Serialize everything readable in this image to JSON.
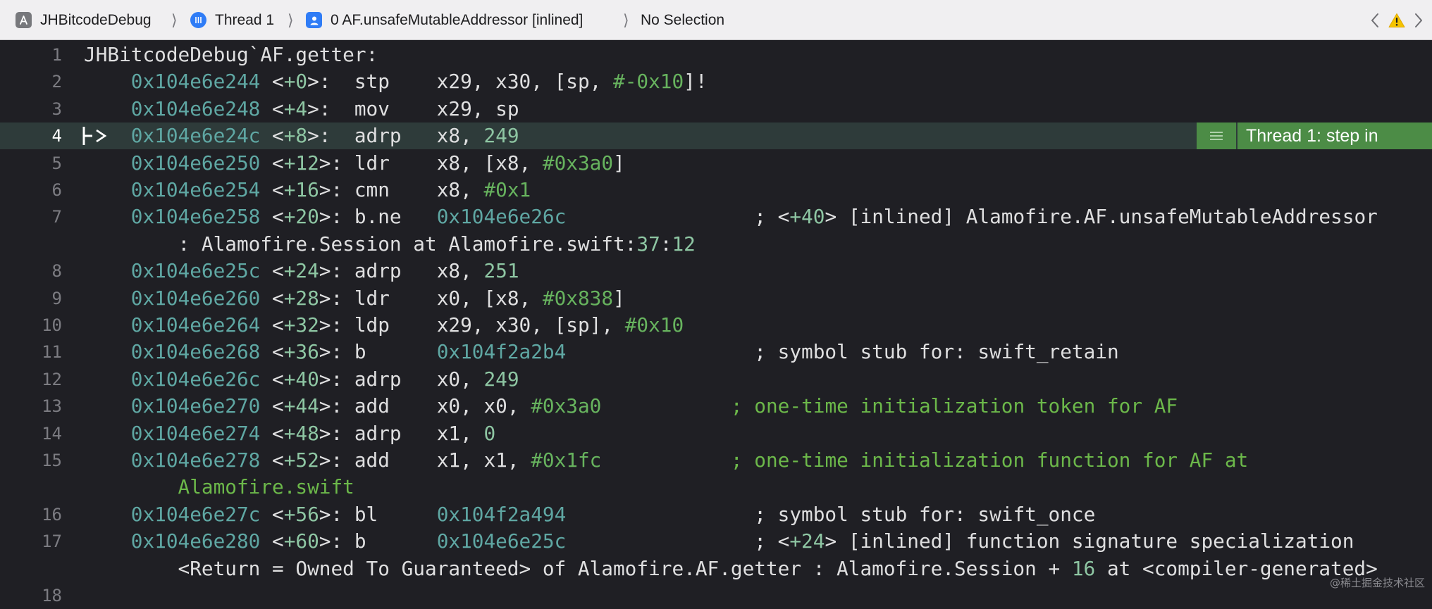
{
  "jumpbar": {
    "project": "JHBitcodeDebug",
    "thread": "Thread 1",
    "frame": "0 AF.unsafeMutableAddressor [inlined]",
    "selection": "No Selection",
    "separator": "⟩"
  },
  "badge": {
    "text": "Thread 1: step in"
  },
  "pc_marker": "├>",
  "watermark": "@稀土掘金技术社区",
  "lines": [
    {
      "n": "1",
      "segs": [
        {
          "c": "c-txt",
          "t": "JHBitcodeDebug`AF.getter:"
        }
      ]
    },
    {
      "n": "2",
      "segs": [
        {
          "c": "c-txt",
          "t": "    "
        },
        {
          "c": "c-addr",
          "t": "0x104e6e244"
        },
        {
          "c": "c-txt",
          "t": " <"
        },
        {
          "c": "c-num",
          "t": "+0"
        },
        {
          "c": "c-txt",
          "t": ">:  stp    x29, x30, [sp, "
        },
        {
          "c": "c-lit",
          "t": "#-0x10"
        },
        {
          "c": "c-txt",
          "t": "]!"
        }
      ]
    },
    {
      "n": "3",
      "segs": [
        {
          "c": "c-txt",
          "t": "    "
        },
        {
          "c": "c-addr",
          "t": "0x104e6e248"
        },
        {
          "c": "c-txt",
          "t": " <"
        },
        {
          "c": "c-num",
          "t": "+4"
        },
        {
          "c": "c-txt",
          "t": ">:  mov    x29, sp"
        }
      ]
    },
    {
      "n": "4",
      "segs": [
        {
          "c": "c-txt",
          "t": "    "
        },
        {
          "c": "c-addr",
          "t": "0x104e6e24c"
        },
        {
          "c": "c-txt",
          "t": " <"
        },
        {
          "c": "c-num",
          "t": "+8"
        },
        {
          "c": "c-txt",
          "t": ">:  adrp   x8, "
        },
        {
          "c": "c-num",
          "t": "249"
        }
      ]
    },
    {
      "n": "5",
      "segs": [
        {
          "c": "c-txt",
          "t": "    "
        },
        {
          "c": "c-addr",
          "t": "0x104e6e250"
        },
        {
          "c": "c-txt",
          "t": " <"
        },
        {
          "c": "c-num",
          "t": "+12"
        },
        {
          "c": "c-txt",
          "t": ">: ldr    x8, [x8, "
        },
        {
          "c": "c-lit",
          "t": "#0x3a0"
        },
        {
          "c": "c-txt",
          "t": "]"
        }
      ]
    },
    {
      "n": "6",
      "segs": [
        {
          "c": "c-txt",
          "t": "    "
        },
        {
          "c": "c-addr",
          "t": "0x104e6e254"
        },
        {
          "c": "c-txt",
          "t": " <"
        },
        {
          "c": "c-num",
          "t": "+16"
        },
        {
          "c": "c-txt",
          "t": ">: cmn    x8, "
        },
        {
          "c": "c-lit",
          "t": "#0x1"
        }
      ]
    },
    {
      "n": "7",
      "segs": [
        {
          "c": "c-txt",
          "t": "    "
        },
        {
          "c": "c-addr",
          "t": "0x104e6e258"
        },
        {
          "c": "c-txt",
          "t": " <"
        },
        {
          "c": "c-num",
          "t": "+20"
        },
        {
          "c": "c-txt",
          "t": ">: b.ne   "
        },
        {
          "c": "c-addr",
          "t": "0x104e6e26c"
        },
        {
          "c": "c-txt",
          "t": "                ; <"
        },
        {
          "c": "c-num",
          "t": "+40"
        },
        {
          "c": "c-txt",
          "t": "> [inlined] Alamofire.AF.unsafeMutableAddressor"
        }
      ]
    },
    {
      "n": "",
      "segs": [
        {
          "c": "c-txt",
          "t": "        : Alamofire.Session at Alamofire.swift:"
        },
        {
          "c": "c-num",
          "t": "37"
        },
        {
          "c": "c-txt",
          "t": ":"
        },
        {
          "c": "c-num",
          "t": "12"
        }
      ]
    },
    {
      "n": "8",
      "segs": [
        {
          "c": "c-txt",
          "t": "    "
        },
        {
          "c": "c-addr",
          "t": "0x104e6e25c"
        },
        {
          "c": "c-txt",
          "t": " <"
        },
        {
          "c": "c-num",
          "t": "+24"
        },
        {
          "c": "c-txt",
          "t": ">: adrp   x8, "
        },
        {
          "c": "c-num",
          "t": "251"
        }
      ]
    },
    {
      "n": "9",
      "segs": [
        {
          "c": "c-txt",
          "t": "    "
        },
        {
          "c": "c-addr",
          "t": "0x104e6e260"
        },
        {
          "c": "c-txt",
          "t": " <"
        },
        {
          "c": "c-num",
          "t": "+28"
        },
        {
          "c": "c-txt",
          "t": ">: ldr    x0, [x8, "
        },
        {
          "c": "c-lit",
          "t": "#0x838"
        },
        {
          "c": "c-txt",
          "t": "]"
        }
      ]
    },
    {
      "n": "10",
      "segs": [
        {
          "c": "c-txt",
          "t": "    "
        },
        {
          "c": "c-addr",
          "t": "0x104e6e264"
        },
        {
          "c": "c-txt",
          "t": " <"
        },
        {
          "c": "c-num",
          "t": "+32"
        },
        {
          "c": "c-txt",
          "t": ">: ldp    x29, x30, [sp], "
        },
        {
          "c": "c-lit",
          "t": "#0x10"
        }
      ]
    },
    {
      "n": "11",
      "segs": [
        {
          "c": "c-txt",
          "t": "    "
        },
        {
          "c": "c-addr",
          "t": "0x104e6e268"
        },
        {
          "c": "c-txt",
          "t": " <"
        },
        {
          "c": "c-num",
          "t": "+36"
        },
        {
          "c": "c-txt",
          "t": ">: b      "
        },
        {
          "c": "c-addr",
          "t": "0x104f2a2b4"
        },
        {
          "c": "c-txt",
          "t": "                ; symbol stub for: swift_retain"
        }
      ]
    },
    {
      "n": "12",
      "segs": [
        {
          "c": "c-txt",
          "t": "    "
        },
        {
          "c": "c-addr",
          "t": "0x104e6e26c"
        },
        {
          "c": "c-txt",
          "t": " <"
        },
        {
          "c": "c-num",
          "t": "+40"
        },
        {
          "c": "c-txt",
          "t": ">: adrp   x0, "
        },
        {
          "c": "c-num",
          "t": "249"
        }
      ]
    },
    {
      "n": "13",
      "segs": [
        {
          "c": "c-txt",
          "t": "    "
        },
        {
          "c": "c-addr",
          "t": "0x104e6e270"
        },
        {
          "c": "c-txt",
          "t": " <"
        },
        {
          "c": "c-num",
          "t": "+44"
        },
        {
          "c": "c-txt",
          "t": ">: add    x0, x0, "
        },
        {
          "c": "c-lit",
          "t": "#0x3a0"
        },
        {
          "c": "c-txt",
          "t": "           "
        },
        {
          "c": "c-cmt",
          "t": "; one-time initialization token for AF"
        }
      ]
    },
    {
      "n": "14",
      "segs": [
        {
          "c": "c-txt",
          "t": "    "
        },
        {
          "c": "c-addr",
          "t": "0x104e6e274"
        },
        {
          "c": "c-txt",
          "t": " <"
        },
        {
          "c": "c-num",
          "t": "+48"
        },
        {
          "c": "c-txt",
          "t": ">: adrp   x1, "
        },
        {
          "c": "c-num",
          "t": "0"
        }
      ]
    },
    {
      "n": "15",
      "segs": [
        {
          "c": "c-txt",
          "t": "    "
        },
        {
          "c": "c-addr",
          "t": "0x104e6e278"
        },
        {
          "c": "c-txt",
          "t": " <"
        },
        {
          "c": "c-num",
          "t": "+52"
        },
        {
          "c": "c-txt",
          "t": ">: add    x1, x1, "
        },
        {
          "c": "c-lit",
          "t": "#0x1fc"
        },
        {
          "c": "c-txt",
          "t": "           "
        },
        {
          "c": "c-cmt",
          "t": "; one-time initialization function for AF at"
        }
      ]
    },
    {
      "n": "",
      "segs": [
        {
          "c": "c-txt",
          "t": "        "
        },
        {
          "c": "c-cmt",
          "t": "Alamofire.swift"
        }
      ]
    },
    {
      "n": "16",
      "segs": [
        {
          "c": "c-txt",
          "t": "    "
        },
        {
          "c": "c-addr",
          "t": "0x104e6e27c"
        },
        {
          "c": "c-txt",
          "t": " <"
        },
        {
          "c": "c-num",
          "t": "+56"
        },
        {
          "c": "c-txt",
          "t": ">: bl     "
        },
        {
          "c": "c-addr",
          "t": "0x104f2a494"
        },
        {
          "c": "c-txt",
          "t": "                ; symbol stub for: swift_once"
        }
      ]
    },
    {
      "n": "17",
      "segs": [
        {
          "c": "c-txt",
          "t": "    "
        },
        {
          "c": "c-addr",
          "t": "0x104e6e280"
        },
        {
          "c": "c-txt",
          "t": " <"
        },
        {
          "c": "c-num",
          "t": "+60"
        },
        {
          "c": "c-txt",
          "t": ">: b      "
        },
        {
          "c": "c-addr",
          "t": "0x104e6e25c"
        },
        {
          "c": "c-txt",
          "t": "                ; <"
        },
        {
          "c": "c-num",
          "t": "+24"
        },
        {
          "c": "c-txt",
          "t": "> [inlined] function signature specialization"
        }
      ]
    },
    {
      "n": "",
      "segs": [
        {
          "c": "c-txt",
          "t": "        <Return = Owned To Guaranteed> of Alamofire.AF.getter : Alamofire.Session + "
        },
        {
          "c": "c-num",
          "t": "16"
        },
        {
          "c": "c-txt",
          "t": " at <compiler-generated>"
        }
      ]
    },
    {
      "n": "18",
      "segs": []
    }
  ]
}
